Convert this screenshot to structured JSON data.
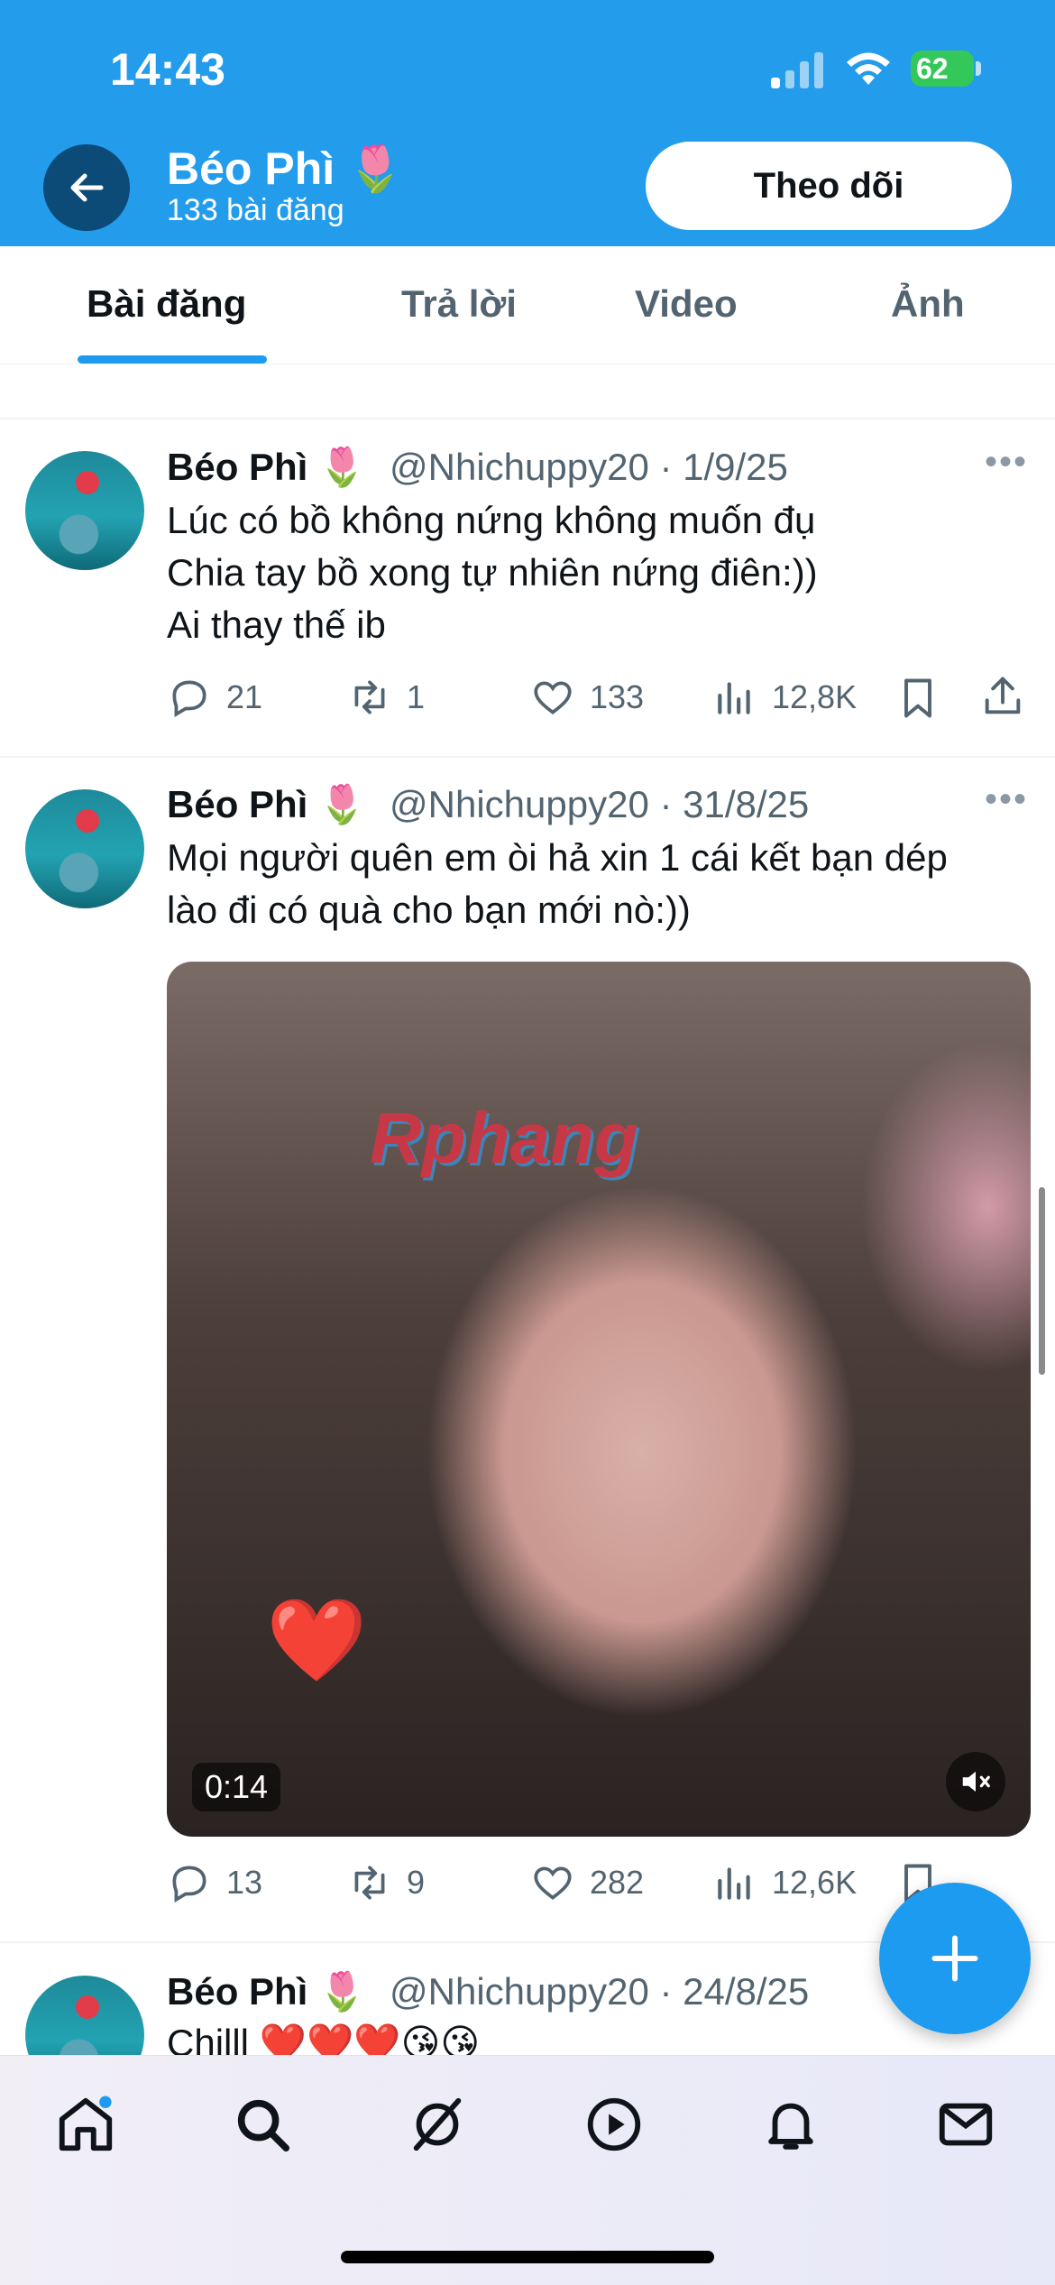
{
  "status_bar": {
    "time": "14:43",
    "battery": "62"
  },
  "header": {
    "name": "Béo Phì 🌷",
    "post_count": "133 bài đăng",
    "follow_label": "Theo dõi"
  },
  "tabs": [
    {
      "label": "Bài đăng",
      "active": true
    },
    {
      "label": "Trả lời",
      "active": false
    },
    {
      "label": "Video",
      "active": false
    },
    {
      "label": "Ảnh",
      "active": false
    }
  ],
  "tweets": [
    {
      "name": "Béo Phì 🌷",
      "handle": "@Nhichuppy20 · 1/9/25",
      "text": "Lúc có bồ không nứng không muốn đụ\nChia tay bồ xong tự nhiên nứng điên:))\nAi thay thế ib",
      "replies": "21",
      "reposts": "1",
      "likes": "133",
      "views": "12,8K"
    },
    {
      "name": "Béo Phì 🌷",
      "handle": "@Nhichuppy20 · 31/8/25",
      "text": "Mọi người quên em òi hả xin 1 cái kết bạn dép\nlào đi có quà cho bạn mới nò:))",
      "video": {
        "watermark": "Rphang",
        "duration": "0:14",
        "heart": "❤️"
      },
      "replies": "13",
      "reposts": "9",
      "likes": "282",
      "views": "12,6K"
    },
    {
      "name": "Béo Phì 🌷",
      "handle": "@Nhichuppy20 · 24/8/25",
      "text": "Chilll ❤️❤️❤️😘😘"
    }
  ],
  "colors": {
    "brand_blue": "#239cec",
    "accent": "#1d9bf0",
    "muted": "#536471"
  }
}
